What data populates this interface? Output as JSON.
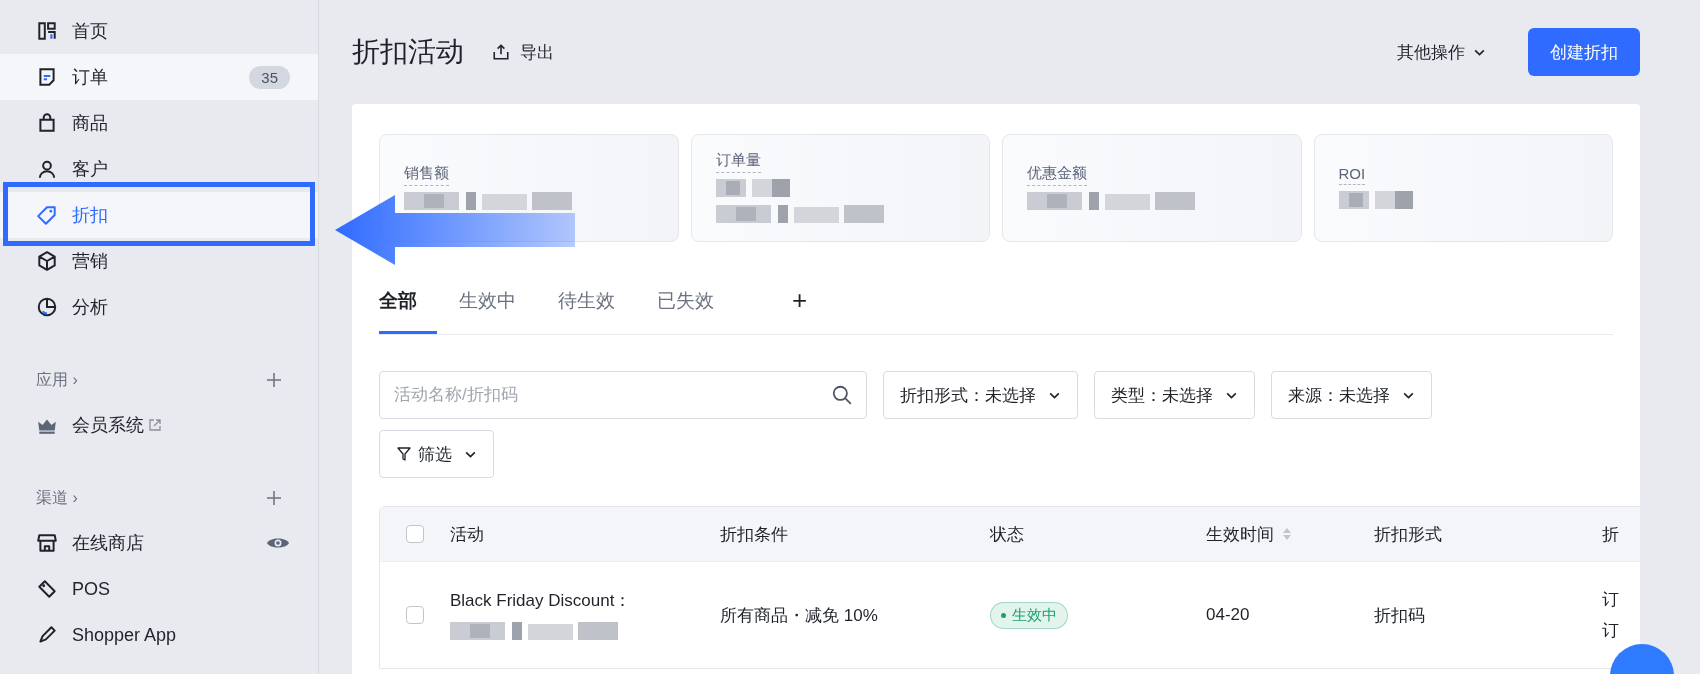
{
  "sidebar": {
    "items": [
      {
        "label": "首页",
        "selected": false,
        "highlighted": false
      },
      {
        "label": "订单",
        "badge": "35",
        "selected": false,
        "highlighted": true
      },
      {
        "label": "商品",
        "selected": false,
        "highlighted": false
      },
      {
        "label": "客户",
        "selected": false,
        "highlighted": false
      },
      {
        "label": "折扣",
        "selected": true,
        "highlighted": false,
        "annotated": true
      },
      {
        "label": "营销",
        "selected": false,
        "highlighted": false
      },
      {
        "label": "分析",
        "selected": false,
        "highlighted": false
      }
    ],
    "sections": [
      {
        "title": "应用",
        "chevron": "›",
        "items": [
          {
            "label": "会员系统",
            "external": true
          }
        ]
      },
      {
        "title": "渠道",
        "chevron": "›",
        "items": [
          {
            "label": "在线商店",
            "visible_toggle": true
          },
          {
            "label": "POS"
          },
          {
            "label": "Shopper App"
          }
        ]
      }
    ]
  },
  "header": {
    "title": "折扣活动",
    "export": "导出",
    "more_actions": "其他操作",
    "create_button": "创建折扣"
  },
  "stats": [
    {
      "label": "销售额",
      "values": [
        {
          "kind": "redacted"
        }
      ]
    },
    {
      "label": "订单量",
      "values": [
        {
          "kind": "redacted_short"
        },
        {
          "kind": "redacted"
        }
      ]
    },
    {
      "label": "优惠金额",
      "values": [
        {
          "kind": "redacted"
        }
      ]
    },
    {
      "label": "ROI",
      "values": [
        {
          "kind": "redacted_short"
        }
      ]
    }
  ],
  "tabs": [
    {
      "label": "全部",
      "selected": true
    },
    {
      "label": "生效中",
      "selected": false
    },
    {
      "label": "待生效",
      "selected": false
    },
    {
      "label": "已失效",
      "selected": false
    }
  ],
  "add_tab": "+",
  "filters": {
    "search": {
      "placeholder": "活动名称/折扣码"
    },
    "dropdowns": [
      "折扣形式：未选择",
      "类型：未选择",
      "来源：未选择"
    ],
    "filter_button": "筛选"
  },
  "table": {
    "all_checked": false,
    "columns": [
      {
        "label": "活动",
        "sortable": false
      },
      {
        "label": "折扣条件",
        "sortable": false
      },
      {
        "label": "状态",
        "sortable": false
      },
      {
        "label": "生效时间",
        "sortable": true
      },
      {
        "label": "折扣形式",
        "sortable": false
      },
      {
        "label": "折",
        "sortable": false
      }
    ],
    "rows": [
      {
        "checked": false,
        "activity": "Black Friday Discount：",
        "activity_detail": {
          "kind": "redacted"
        },
        "condition": "所有商品・减免 10%",
        "status": {
          "label": "生效中",
          "color": "#19a36b"
        },
        "time": "04-20",
        "form": "折扣码",
        "column_6": [
          "订",
          "订"
        ]
      }
    ]
  },
  "annotation": {
    "kind": "arrow"
  }
}
